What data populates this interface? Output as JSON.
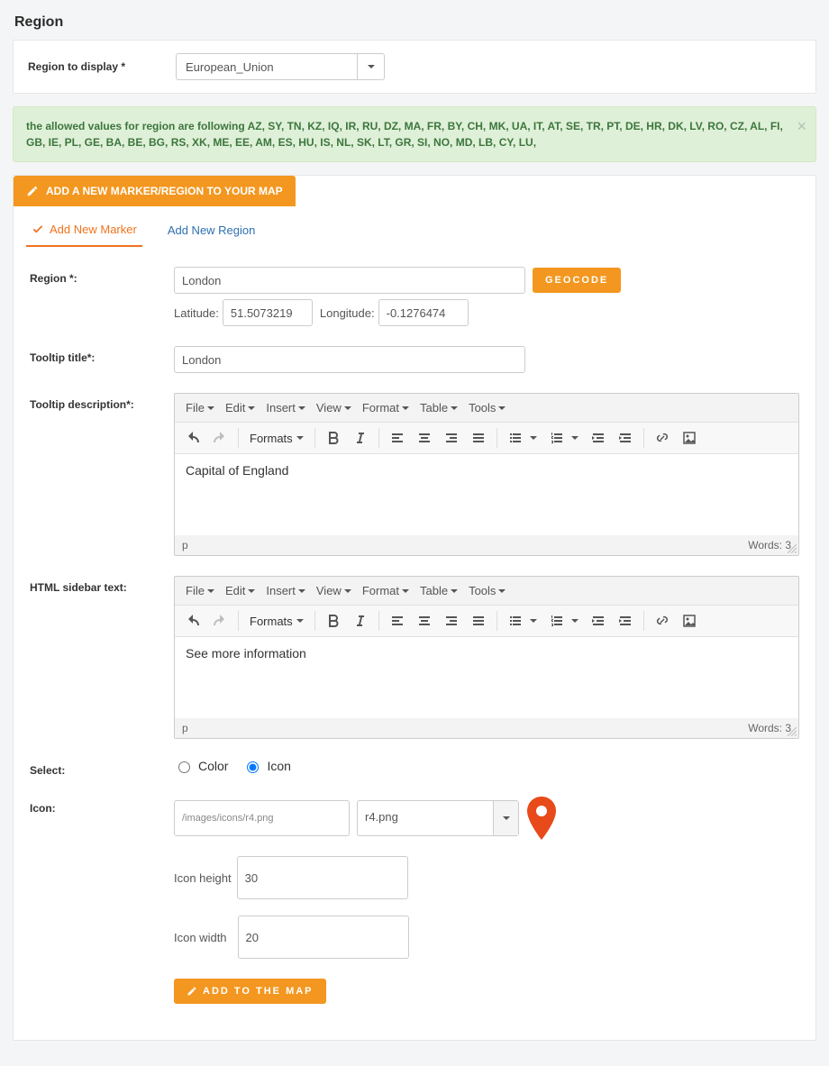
{
  "section_title": "Region",
  "region_select": {
    "label": "Region to display *",
    "value": "European_Union"
  },
  "alert_text": "the allowed values for region are following AZ, SY, TN, KZ, IQ, IR, RU, DZ, MA, FR, BY, CH, MK, UA, IT, AT, SE, TR, PT, DE, HR, DK, LV, RO, CZ, AL, FI, GB, IE, PL, GE, BA, BE, BG, RS, XK, ME, EE, AM, ES, HU, IS, NL, SK, LT, GR, SI, NO, MD, LB, CY, LU,",
  "panel2_title": "ADD A NEW MARKER/REGION TO YOUR MAP",
  "tabs": {
    "marker": "Add New Marker",
    "region": "Add New Region"
  },
  "form": {
    "region": {
      "label": "Region *:",
      "value": "London",
      "geocode_btn": "GEOCODE",
      "lat_label": "Latitude:",
      "lat_value": "51.5073219",
      "lng_label": "Longitude:",
      "lng_value": "-0.1276474"
    },
    "tooltip_title": {
      "label": "Tooltip title*:",
      "value": "London"
    },
    "tooltip_desc": {
      "label": "Tooltip description*:",
      "content": "Capital of England",
      "path": "p",
      "words": "Words: 3"
    },
    "sidebar_text": {
      "label": "HTML sidebar text:",
      "content": "See more information",
      "path": "p",
      "words": "Words: 3"
    },
    "editor_menu": {
      "file": "File",
      "edit": "Edit",
      "insert": "Insert",
      "view": "View",
      "format": "Format",
      "table": "Table",
      "tools": "Tools",
      "formats": "Formats"
    },
    "select_row": {
      "label": "Select:",
      "opt_color": "Color",
      "opt_icon": "Icon"
    },
    "icon": {
      "label": "Icon:",
      "path": "/images/icons/r4.png",
      "file": "r4.png",
      "height_label": "Icon height",
      "height_value": "30",
      "width_label": "Icon width",
      "width_value": "20"
    },
    "add_btn": "ADD TO THE MAP"
  }
}
